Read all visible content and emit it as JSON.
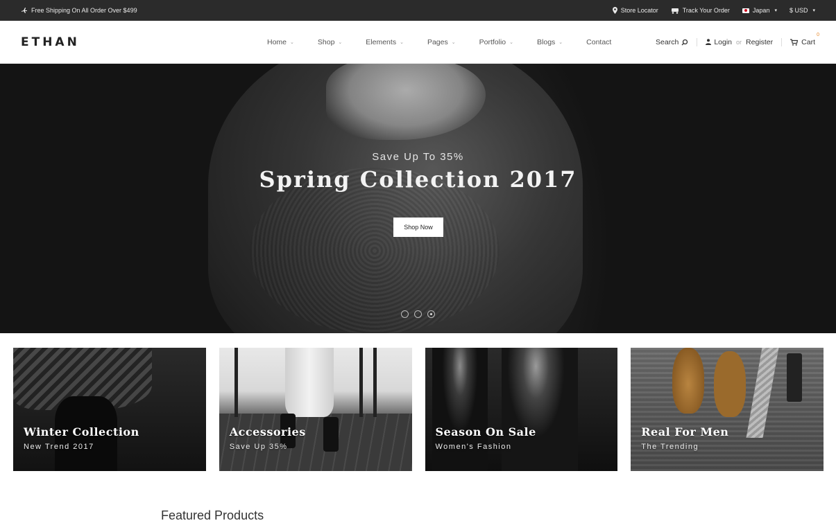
{
  "topbar": {
    "shipping": "Free Shipping On All Order Over $499",
    "store_locator": "Store Locator",
    "track_order": "Track Your Order",
    "country": "Japan",
    "currency": "$ USD"
  },
  "header": {
    "logo": "ETHAN",
    "nav": [
      {
        "label": "Home",
        "has_caret": true
      },
      {
        "label": "Shop",
        "has_caret": true
      },
      {
        "label": "Elements",
        "has_caret": true
      },
      {
        "label": "Pages",
        "has_caret": true
      },
      {
        "label": "Portfolio",
        "has_caret": true
      },
      {
        "label": "Blogs",
        "has_caret": true
      },
      {
        "label": "Contact",
        "has_caret": false
      }
    ],
    "search_label": "Search",
    "login_label": "Login",
    "or_label": "or",
    "register_label": "Register",
    "cart_label": "Cart",
    "cart_count": "0"
  },
  "hero": {
    "subtitle": "Save Up To 35%",
    "title": "Spring Collection 2017",
    "button_label": "Shop Now",
    "slide_count": 3,
    "active_slide": 3
  },
  "banners": [
    {
      "title": "Winter Collection",
      "subtitle": "New Trend 2017"
    },
    {
      "title": "Accessories",
      "subtitle": "Save Up 35%"
    },
    {
      "title": "Season On Sale",
      "subtitle": "Women's Fashion"
    },
    {
      "title": "Real For Men",
      "subtitle": "The Trending"
    }
  ],
  "featured": {
    "title": "Featured Products"
  },
  "icons": {
    "shipping": "plane-icon",
    "store_locator": "map-pin-icon",
    "track_order": "truck-icon",
    "country": "japan-flag-icon",
    "search": "search-icon",
    "login": "user-icon",
    "cart": "cart-icon"
  },
  "colors": {
    "topbar": "#2b2b2b",
    "cart_badge": "#e88a2e"
  }
}
